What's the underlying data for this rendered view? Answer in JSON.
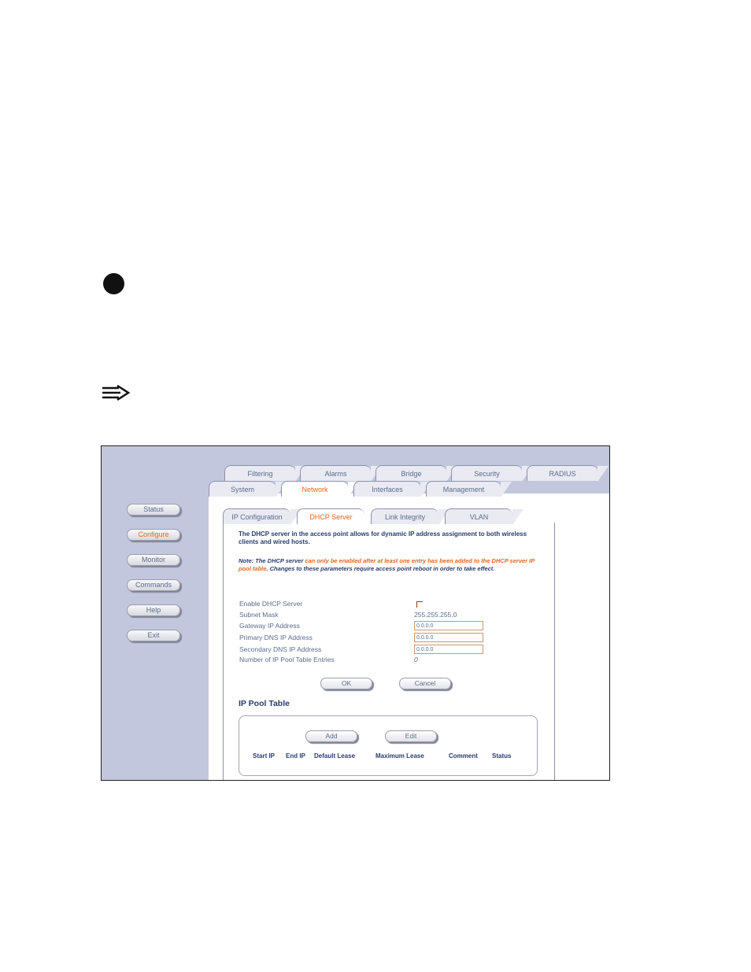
{
  "top_tabs": [
    "Filtering",
    "Alarms",
    "Bridge",
    "Security",
    "RADIUS"
  ],
  "second_tabs": [
    "System",
    "Network",
    "Interfaces",
    "Management"
  ],
  "sub_tabs": [
    "IP Configuration",
    "DHCP Server",
    "Link Integrity",
    "VLAN"
  ],
  "sidebar": [
    "Status",
    "Configure",
    "Monitor",
    "Commands",
    "Help",
    "Exit"
  ],
  "description": "The DHCP server in the access point allows for dynamic IP address assignment to both wireless clients and wired hosts.",
  "note": {
    "prefix": "Note: The DHCP server ",
    "highlight": "can only be enabled after at least one entry has been added to the DHCP server IP pool table",
    "suffix": ". Changes to these parameters require access point reboot in order to take effect."
  },
  "fields": {
    "enable_dhcp": "Enable DHCP Server",
    "subnet_mask_label": "Subnet Mask",
    "subnet_mask_value": "255.255.255.0",
    "gateway_label": "Gateway IP Address",
    "gateway_value": "0.0.0.0",
    "primary_dns_label": "Primary DNS IP Address",
    "primary_dns_value": "0.0.0.0",
    "secondary_dns_label": "Secondary DNS IP Address",
    "secondary_dns_value": "0.0.0.0",
    "entries_label": "Number of IP Pool Table Entries",
    "entries_value": "0"
  },
  "buttons": {
    "ok": "OK",
    "cancel": "Cancel",
    "add": "Add",
    "edit": "Edit"
  },
  "pool": {
    "title": "IP Pool Table",
    "columns": [
      "Start IP",
      "End IP",
      "Default Lease",
      "Maximum Lease",
      "Comment",
      "Status"
    ]
  },
  "colors": {
    "accent": "#e8651c",
    "sidebar_bg": "#c3c7dd",
    "text": "#5a6c8c",
    "heading": "#283c6c"
  },
  "icons": {
    "bullet": "filled-circle-icon",
    "note": "note-arrow-icon"
  }
}
